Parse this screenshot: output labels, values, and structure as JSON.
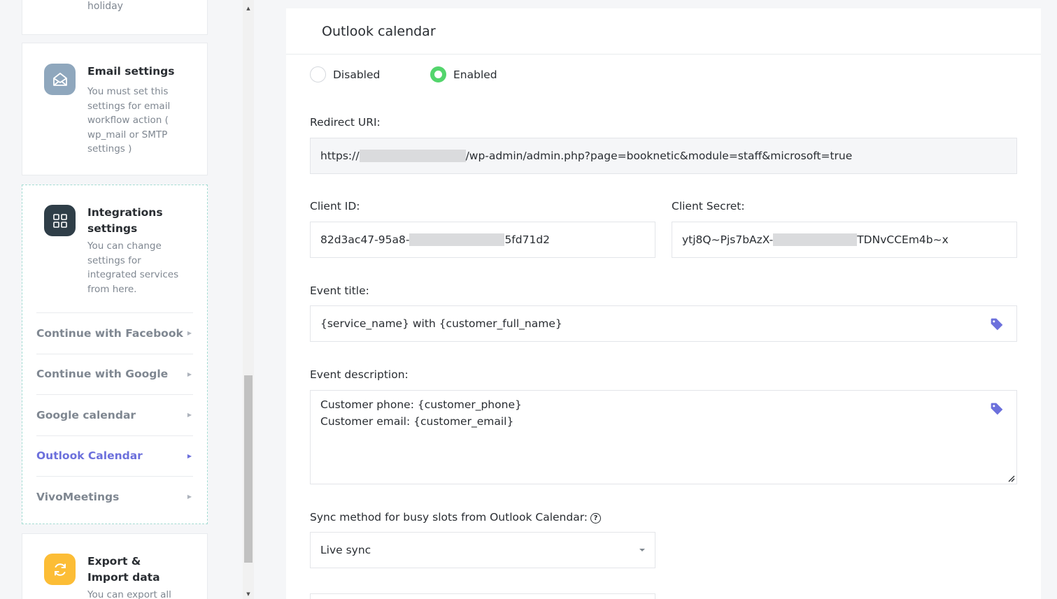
{
  "sidebar": {
    "holiday_desc": "holiday",
    "email": {
      "title": "Email settings",
      "description": "You must set this settings for email workflow action ( wp_mail or SMTP settings )",
      "icon": "envelope-open-icon"
    },
    "integrations": {
      "title": "Integrations settings",
      "description": "You can change settings for integrated services from here.",
      "icon": "grid-integration-icon",
      "items": [
        {
          "label": "Continue with Facebook"
        },
        {
          "label": "Continue with Google"
        },
        {
          "label": "Google calendar"
        },
        {
          "label": "Outlook Calendar"
        },
        {
          "label": "VivoMeetings"
        }
      ],
      "active_item": "Outlook Calendar"
    },
    "export": {
      "title": "Export & Import data",
      "description": "You can export all",
      "icon": "sync-icon"
    }
  },
  "panel": {
    "title": "Outlook calendar",
    "radio": {
      "disabled_label": "Disabled",
      "enabled_label": "Enabled",
      "selected": "Enabled"
    },
    "redirect": {
      "label": "Redirect URI:",
      "prefix": "https://",
      "suffix": "/wp-admin/admin.php?page=booknetic&module=staff&microsoft=true"
    },
    "client_id": {
      "label": "Client ID:",
      "prefix": "82d3ac47-95a8-",
      "suffix": "5fd71d2"
    },
    "client_secret": {
      "label": "Client Secret:",
      "prefix": "ytj8Q~Pjs7bAzX-",
      "suffix": "TDNvCCEm4b~x"
    },
    "event_title": {
      "label": "Event title:",
      "value": "{service_name} with {customer_full_name}"
    },
    "event_description": {
      "label": "Event description:",
      "line1": "Customer phone: {customer_phone}",
      "line2": "Customer email: {customer_email}"
    },
    "sync": {
      "label": "Sync method for busy slots from Outlook Calendar:",
      "value": "Live sync"
    }
  },
  "colors": {
    "accent": "#6c70dc",
    "enabled_green": "#53d56c",
    "email_icon_bg": "#8fa7bd",
    "integ_icon_bg": "#2f3e48",
    "export_icon_bg": "#fcbd36"
  }
}
